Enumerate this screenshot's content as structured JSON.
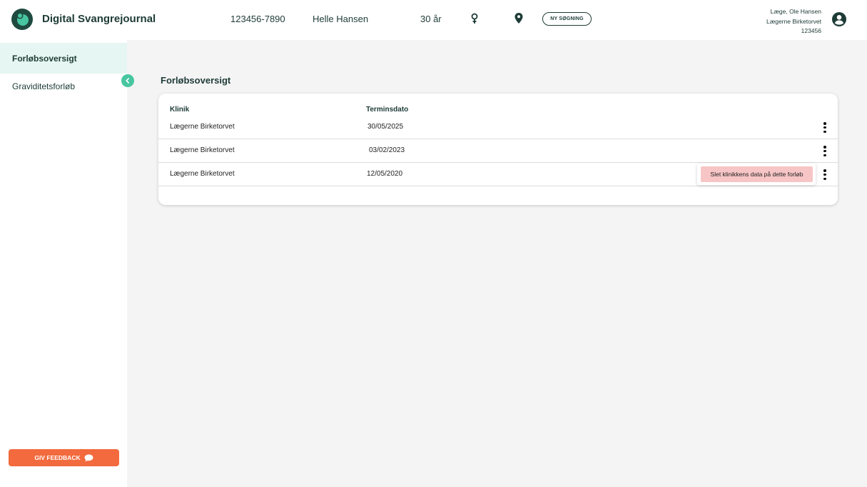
{
  "header": {
    "app_title": "Digital Svangrejournal",
    "cpr": "123456-7890",
    "patient_name": "Helle Hansen",
    "age": "30 år",
    "new_search_label": "NY SØGNING",
    "user": {
      "role_name": "Læge, Ole Hansen",
      "clinic": "Lægerne Birketorvet",
      "id": "123456"
    },
    "icons": [
      "logo-icon",
      "female-icon",
      "location-pin-icon",
      "user-account-icon"
    ]
  },
  "sidebar": {
    "items": [
      {
        "label": "Forløbsoversigt",
        "active": true
      },
      {
        "label": "Graviditetsforløb",
        "active": false
      }
    ],
    "feedback_label": "GIV FEEDBACK"
  },
  "main": {
    "title": "Forløbsoversigt",
    "table": {
      "columns": [
        "Klinik",
        "Terminsdato"
      ],
      "rows": [
        {
          "clinic": "Lægerne Birketorvet",
          "due_date": "30/05/2025"
        },
        {
          "clinic": "Lægerne Birketorvet",
          "due_date": "03/02/2023"
        },
        {
          "clinic": "Lægerne Birketorvet",
          "due_date": "12/05/2020"
        }
      ]
    },
    "context_menu": {
      "items": [
        "Slet klinikkens data på dette forløb"
      ]
    }
  },
  "colors": {
    "primary": "#1d3b36",
    "accent_teal": "#47c6a0",
    "active_bg": "#e6f6f2",
    "feedback_orange": "#f26a3d",
    "danger_bg": "#f7c5c5"
  }
}
